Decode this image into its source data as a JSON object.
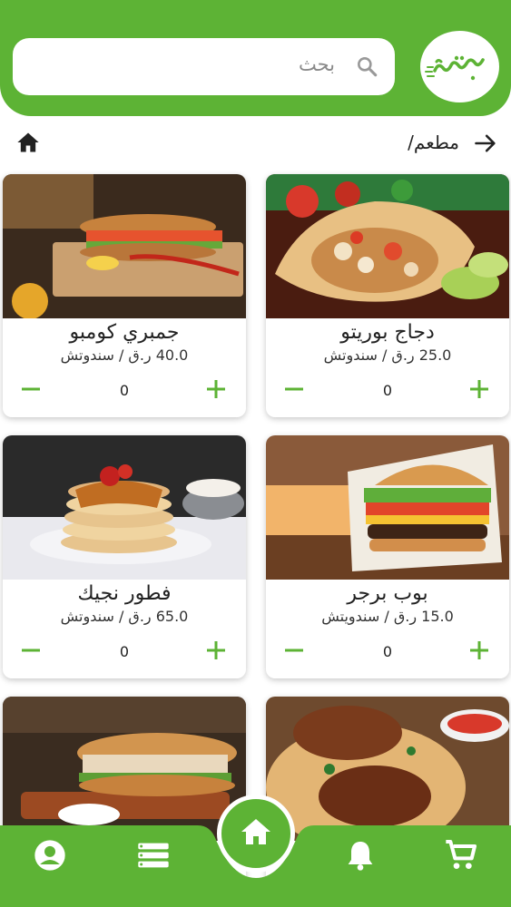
{
  "colors": {
    "brand": "#5db335",
    "white": "#ffffff"
  },
  "search": {
    "placeholder": "بحث",
    "icon": "search-icon"
  },
  "breadcrumb": {
    "label": "مطعم/",
    "icons": [
      "home-icon",
      "arrow-right-icon"
    ]
  },
  "products": [
    {
      "name": "دجاج بوريتو",
      "price": "25.0 ر.ق / سندوتش",
      "qty": "0"
    },
    {
      "name": "جمبري كومبو",
      "price": "40.0 ر.ق / سندوتش",
      "qty": "0"
    },
    {
      "name": "بوب برجر",
      "price": "15.0 ر.ق / سندويتش",
      "qty": "0"
    },
    {
      "name": "فطور نجيك",
      "price": "65.0 ر.ق / سندوتش",
      "qty": "0"
    }
  ],
  "nav": {
    "items": [
      "cart-icon",
      "bell-icon",
      "home-icon",
      "list-icon",
      "account-icon"
    ]
  }
}
